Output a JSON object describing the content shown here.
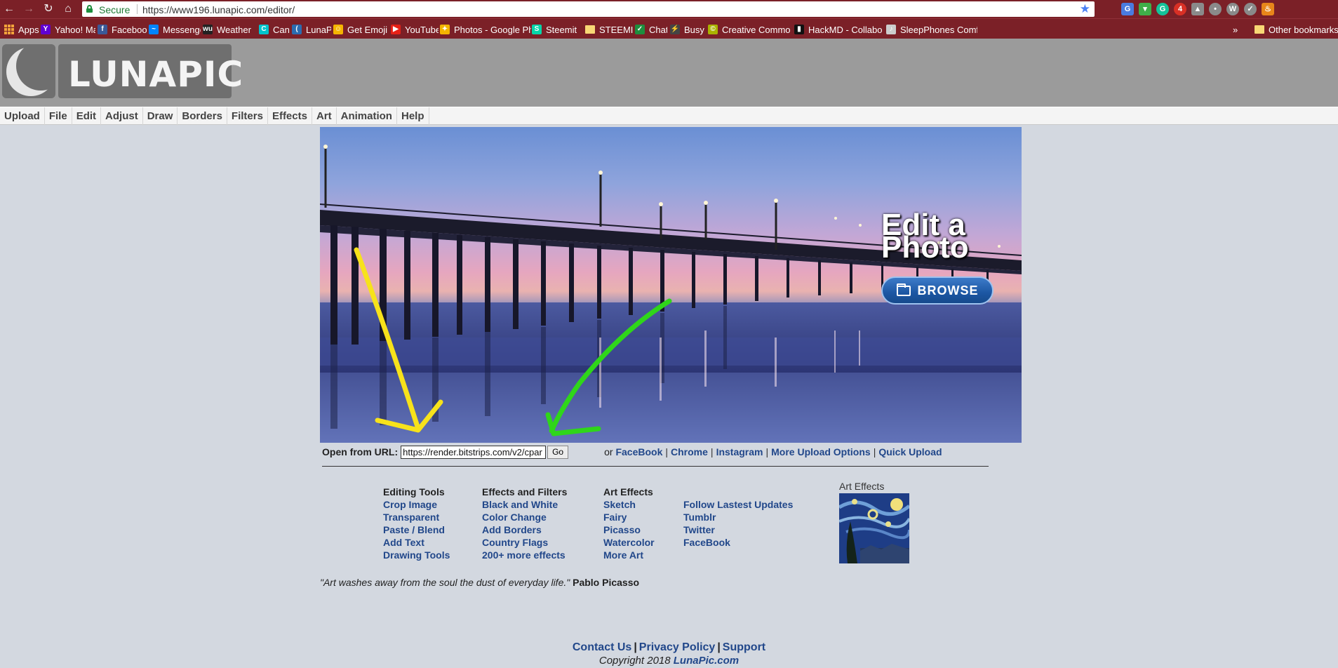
{
  "browser": {
    "secure_label": "Secure",
    "url": "https://www196.lunapic.com/editor/",
    "bookmarks": [
      {
        "label": "Apps",
        "icon": "apps-grid-icon"
      },
      {
        "label": "Yahoo! Mail",
        "icon": "yahoo-icon",
        "glyph": "Y",
        "color": "#6001d2"
      },
      {
        "label": "Facebook",
        "icon": "facebook-icon",
        "glyph": "f",
        "color": "#3b5998"
      },
      {
        "label": "Messenger",
        "icon": "messenger-icon",
        "glyph": "~",
        "color": "#0084ff"
      },
      {
        "label": "Weather",
        "icon": "weather-icon",
        "glyph": "wu",
        "color": "#222222"
      },
      {
        "label": "Canva",
        "icon": "canva-icon",
        "glyph": "C",
        "color": "#00c4cc"
      },
      {
        "label": "LunaPic",
        "icon": "lunapic-icon",
        "glyph": "(",
        "color": "#2b6cb0"
      },
      {
        "label": "Get Emoji",
        "icon": "emoji-icon",
        "glyph": "☺",
        "color": "#f5b400"
      },
      {
        "label": "YouTube",
        "icon": "youtube-icon",
        "glyph": "▶",
        "color": "#e62117"
      },
      {
        "label": "Photos - Google Pho",
        "icon": "google-photos-icon",
        "glyph": "✦",
        "color": "#f4b400"
      },
      {
        "label": "Steemit",
        "icon": "steemit-icon",
        "glyph": "S",
        "color": "#06d6a9"
      },
      {
        "label": "STEEMIT",
        "icon": "bookmark-folder-icon",
        "glyph": "",
        "color": "#f8d775"
      },
      {
        "label": "Chat",
        "icon": "chat-icon",
        "glyph": "✓",
        "color": "#1e8e3e"
      },
      {
        "label": "Busy",
        "icon": "busy-icon",
        "glyph": "⚡",
        "color": "#444444"
      },
      {
        "label": "Creative Commons M",
        "icon": "creative-commons-icon",
        "glyph": "©",
        "color": "#aab200"
      },
      {
        "label": "HackMD - Collaborat",
        "icon": "hackmd-icon",
        "glyph": "▮",
        "color": "#111111"
      },
      {
        "label": "SleepPhones Comfor",
        "icon": "sleepphones-icon",
        "glyph": "♪",
        "color": "#cccccc"
      }
    ],
    "overflow_chevron": "»",
    "other_bookmarks": "Other bookmarks"
  },
  "site": {
    "logo_text": "LUNAPIC",
    "menu": [
      "Upload",
      "File",
      "Edit",
      "Adjust",
      "Draw",
      "Borders",
      "Filters",
      "Effects",
      "Art",
      "Animation",
      "Help"
    ]
  },
  "hero": {
    "title_line1": "Edit a",
    "title_line2": "Photo",
    "browse_label": "BROWSE"
  },
  "upload": {
    "label": "Open from URL:",
    "url_value": "https://render.bitstrips.com/v2/cpar",
    "go_label": "Go",
    "or_text": "or",
    "links": [
      "FaceBook",
      "Chrome",
      "Instagram",
      "More Upload Options",
      "Quick Upload"
    ]
  },
  "columns": [
    {
      "heading": "Editing Tools",
      "links": [
        "Crop Image",
        "Transparent",
        "Paste / Blend",
        "Add Text",
        "Drawing Tools"
      ]
    },
    {
      "heading": "Effects and Filters",
      "links": [
        "Black and White",
        "Color Change",
        "Add Borders",
        "Country Flags",
        "200+ more effects"
      ]
    },
    {
      "heading": "Art Effects",
      "links": [
        "Sketch",
        "Fairy",
        "Picasso",
        "Watercolor",
        "More Art"
      ]
    },
    {
      "heading": "",
      "links": [
        "Follow Lastest Updates",
        "Tumblr",
        "Twitter",
        "FaceBook"
      ]
    }
  ],
  "art_thumb_label": "Art Effects",
  "quote": {
    "text": "\"Art washes away from the soul the dust of everyday life.\"",
    "author": "Pablo Picasso"
  },
  "footer": {
    "links": [
      "Contact Us",
      "Privacy Policy",
      "Support"
    ],
    "copyright_prefix": "Copyright 2018",
    "copyright_brand": "LunaPic.com"
  }
}
